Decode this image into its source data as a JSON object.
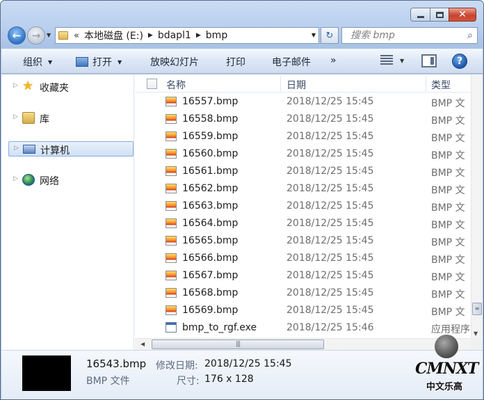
{
  "window": {
    "caption": {
      "minimize": "—",
      "maximize": "",
      "close": "✕"
    }
  },
  "nav": {
    "back_glyph": "←",
    "forward_glyph": "→",
    "breadcrumb": {
      "overflow": "«",
      "items": [
        "本地磁盘 (E:)",
        "bdapl1",
        "bmp"
      ]
    },
    "refresh_glyph": "↻",
    "search": {
      "placeholder": "搜索 bmp"
    }
  },
  "toolbar": {
    "organize": "组织",
    "open": "打开",
    "slideshow": "放映幻灯片",
    "print": "打印",
    "email": "电子邮件",
    "more": "»",
    "help": "?"
  },
  "sidebar": {
    "items": [
      {
        "label": "收藏夹",
        "icon": "star-icon"
      },
      {
        "label": "库",
        "icon": "library-icon"
      },
      {
        "label": "计算机",
        "icon": "computer-icon",
        "selected": true
      },
      {
        "label": "网络",
        "icon": "network-icon"
      }
    ]
  },
  "columns": {
    "name": "名称",
    "date": "日期",
    "type": "类型"
  },
  "files": [
    {
      "name": "16557.bmp",
      "date": "2018/12/25 15:45",
      "type": "BMP 文",
      "icon": "bmp"
    },
    {
      "name": "16558.bmp",
      "date": "2018/12/25 15:45",
      "type": "BMP 文",
      "icon": "bmp"
    },
    {
      "name": "16559.bmp",
      "date": "2018/12/25 15:45",
      "type": "BMP 文",
      "icon": "bmp"
    },
    {
      "name": "16560.bmp",
      "date": "2018/12/25 15:45",
      "type": "BMP 文",
      "icon": "bmp"
    },
    {
      "name": "16561.bmp",
      "date": "2018/12/25 15:45",
      "type": "BMP 文",
      "icon": "bmp"
    },
    {
      "name": "16562.bmp",
      "date": "2018/12/25 15:45",
      "type": "BMP 文",
      "icon": "bmp"
    },
    {
      "name": "16563.bmp",
      "date": "2018/12/25 15:45",
      "type": "BMP 文",
      "icon": "bmp"
    },
    {
      "name": "16564.bmp",
      "date": "2018/12/25 15:45",
      "type": "BMP 文",
      "icon": "bmp"
    },
    {
      "name": "16565.bmp",
      "date": "2018/12/25 15:45",
      "type": "BMP 文",
      "icon": "bmp"
    },
    {
      "name": "16566.bmp",
      "date": "2018/12/25 15:45",
      "type": "BMP 文",
      "icon": "bmp"
    },
    {
      "name": "16567.bmp",
      "date": "2018/12/25 15:45",
      "type": "BMP 文",
      "icon": "bmp"
    },
    {
      "name": "16568.bmp",
      "date": "2018/12/25 15:45",
      "type": "BMP 文",
      "icon": "bmp"
    },
    {
      "name": "16569.bmp",
      "date": "2018/12/25 15:45",
      "type": "BMP 文",
      "icon": "bmp"
    },
    {
      "name": "bmp_to_rgf.exe",
      "date": "2018/12/25 15:46",
      "type": "应用程序",
      "icon": "exe"
    }
  ],
  "details": {
    "filename": "16543.bmp",
    "filetype": "BMP 文件",
    "modified_label": "修改日期:",
    "modified_value": "2018/12/25 15:45",
    "size_label": "尺寸:",
    "size_value": "176 x 128"
  },
  "watermark": {
    "line1": "CMNXT",
    "line2": "中文乐高"
  }
}
